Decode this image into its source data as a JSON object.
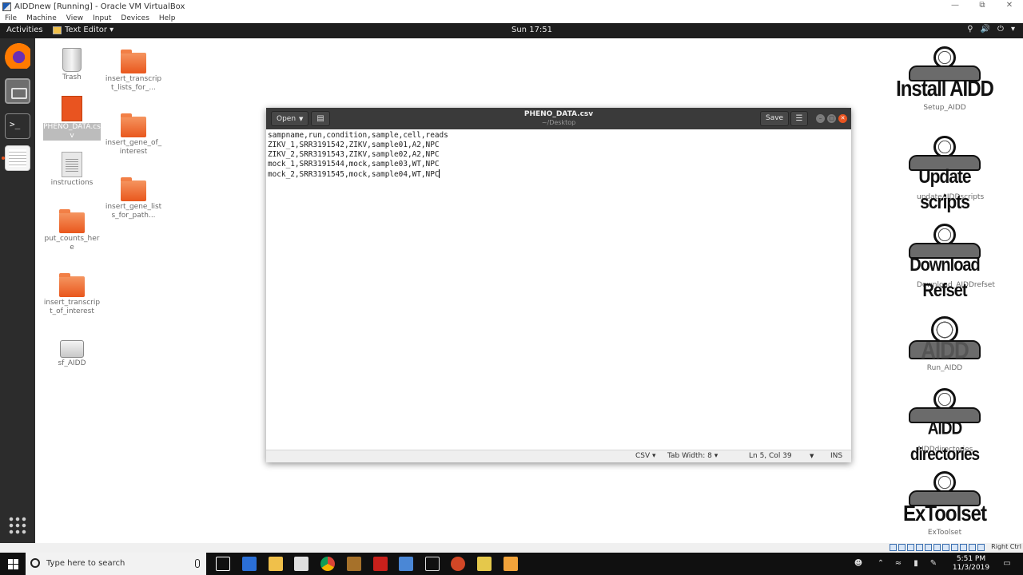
{
  "host_window": {
    "title": "AIDDnew [Running] - Oracle VM VirtualBox",
    "menu": [
      "File",
      "Machine",
      "View",
      "Input",
      "Devices",
      "Help"
    ]
  },
  "top_panel": {
    "activities": "Activities",
    "app_menu": "Text Editor ▾",
    "clock": "Sun 17:51"
  },
  "desktop_icons": [
    {
      "label": "Trash",
      "icon": "trash-icon"
    },
    {
      "label": "insert_transcript_lists_for_...",
      "icon": "folder-icon"
    },
    {
      "label": "PHENO_DATA.csv",
      "icon": "csv-file-icon"
    },
    {
      "label": "insert_gene_of_interest",
      "icon": "folder-icon"
    },
    {
      "label": "instructions",
      "icon": "text-file-icon"
    },
    {
      "label": "insert_gene_lists_for_path...",
      "icon": "folder-icon"
    },
    {
      "label": "put_counts_here",
      "icon": "folder-icon"
    },
    {
      "label": "insert_transcript_of_interest",
      "icon": "folder-icon"
    },
    {
      "label": "sf_AIDD",
      "icon": "drive-icon"
    }
  ],
  "aidd_icons": [
    {
      "caption": "Install AIDD",
      "label": "Setup_AIDD"
    },
    {
      "caption": "Update scripts",
      "label": "updateAIDDscripts"
    },
    {
      "caption": "Download Refset",
      "label": "Download_AIDDrefset"
    },
    {
      "caption": "AIDD",
      "label": "Run_AIDD"
    },
    {
      "caption": "AIDD directories",
      "label": "AIDDdirectories"
    },
    {
      "caption": "ExToolset",
      "label": "ExToolset"
    }
  ],
  "editor": {
    "open_label": "Open",
    "title": "PHENO_DATA.csv",
    "subtitle": "~/Desktop",
    "save_label": "Save",
    "lines": [
      "sampname,run,condition,sample,cell,reads",
      "ZIKV_1,SRR3191542,ZIKV,sample01,A2,NPC",
      "ZIKV_2,SRR3191543,ZIKV,sample02,A2,NPC",
      "mock_1,SRR3191544,mock,sample03,WT,NPC",
      "mock_2,SRR3191545,mock,sample04,WT,NPC"
    ],
    "status": {
      "language": "CSV ▾",
      "tab_width": "Tab Width: 8 ▾",
      "position": "Ln 5, Col 39",
      "mode": "INS"
    }
  },
  "taskbar": {
    "search_placeholder": "Type here to search",
    "time": "5:51 PM",
    "date": "11/3/2019",
    "host_key": "Right Ctrl"
  }
}
